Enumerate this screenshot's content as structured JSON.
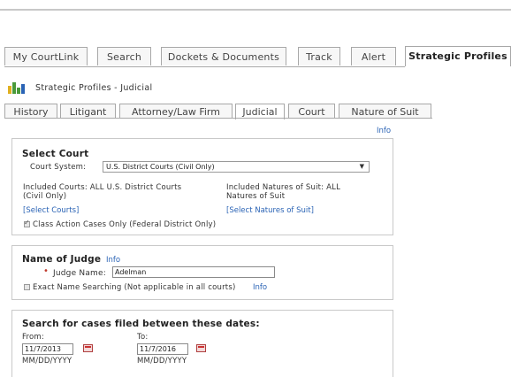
{
  "main_tabs": [
    {
      "label": "My CourtLink"
    },
    {
      "label": "Search"
    },
    {
      "label": "Dockets & Documents"
    },
    {
      "label": "Track"
    },
    {
      "label": "Alert"
    },
    {
      "label": "Strategic Profiles"
    }
  ],
  "header": {
    "title": "Strategic Profiles - Judicial",
    "icon": "bar-chart-icon"
  },
  "sub_tabs": [
    {
      "label": "History"
    },
    {
      "label": "Litigant"
    },
    {
      "label": "Attorney/Law Firm"
    },
    {
      "label": "Judicial"
    },
    {
      "label": "Court"
    },
    {
      "label": "Nature of Suit"
    }
  ],
  "info_label": "Info",
  "select_court": {
    "title": "Select Court",
    "court_system_label": "Court System:",
    "court_system_value": "U.S. District Courts (Civil Only)",
    "included_courts_line1": "Included Courts: ALL U.S. District Courts",
    "included_courts_line2": "(Civil Only)",
    "included_nature_line1": "Included Natures of Suit: ALL",
    "included_nature_line2": "Natures of Suit",
    "select_courts_link": "[Select Courts]",
    "select_nature_link": "[Select Natures of Suit]",
    "class_action_label": "Class Action Cases Only (Federal District Only)",
    "class_action_checked": true
  },
  "judge": {
    "title": "Name of Judge",
    "judge_name_label": "Judge Name:",
    "judge_name_value": "Adelman",
    "exact_label": "Exact Name Searching (Not applicable in all courts)",
    "exact_checked": false
  },
  "dates": {
    "title": "Search for cases filed between these dates:",
    "from_label": "From:",
    "from_value": "11/7/2013",
    "to_label": "To:",
    "to_value": "11/7/2016",
    "format_hint": "MM/DD/YYYY"
  },
  "colors": {
    "link": "#2a63b5",
    "required": "#c0392b",
    "icon_green": "#4a9a3a",
    "icon_yellow": "#e0b020"
  }
}
